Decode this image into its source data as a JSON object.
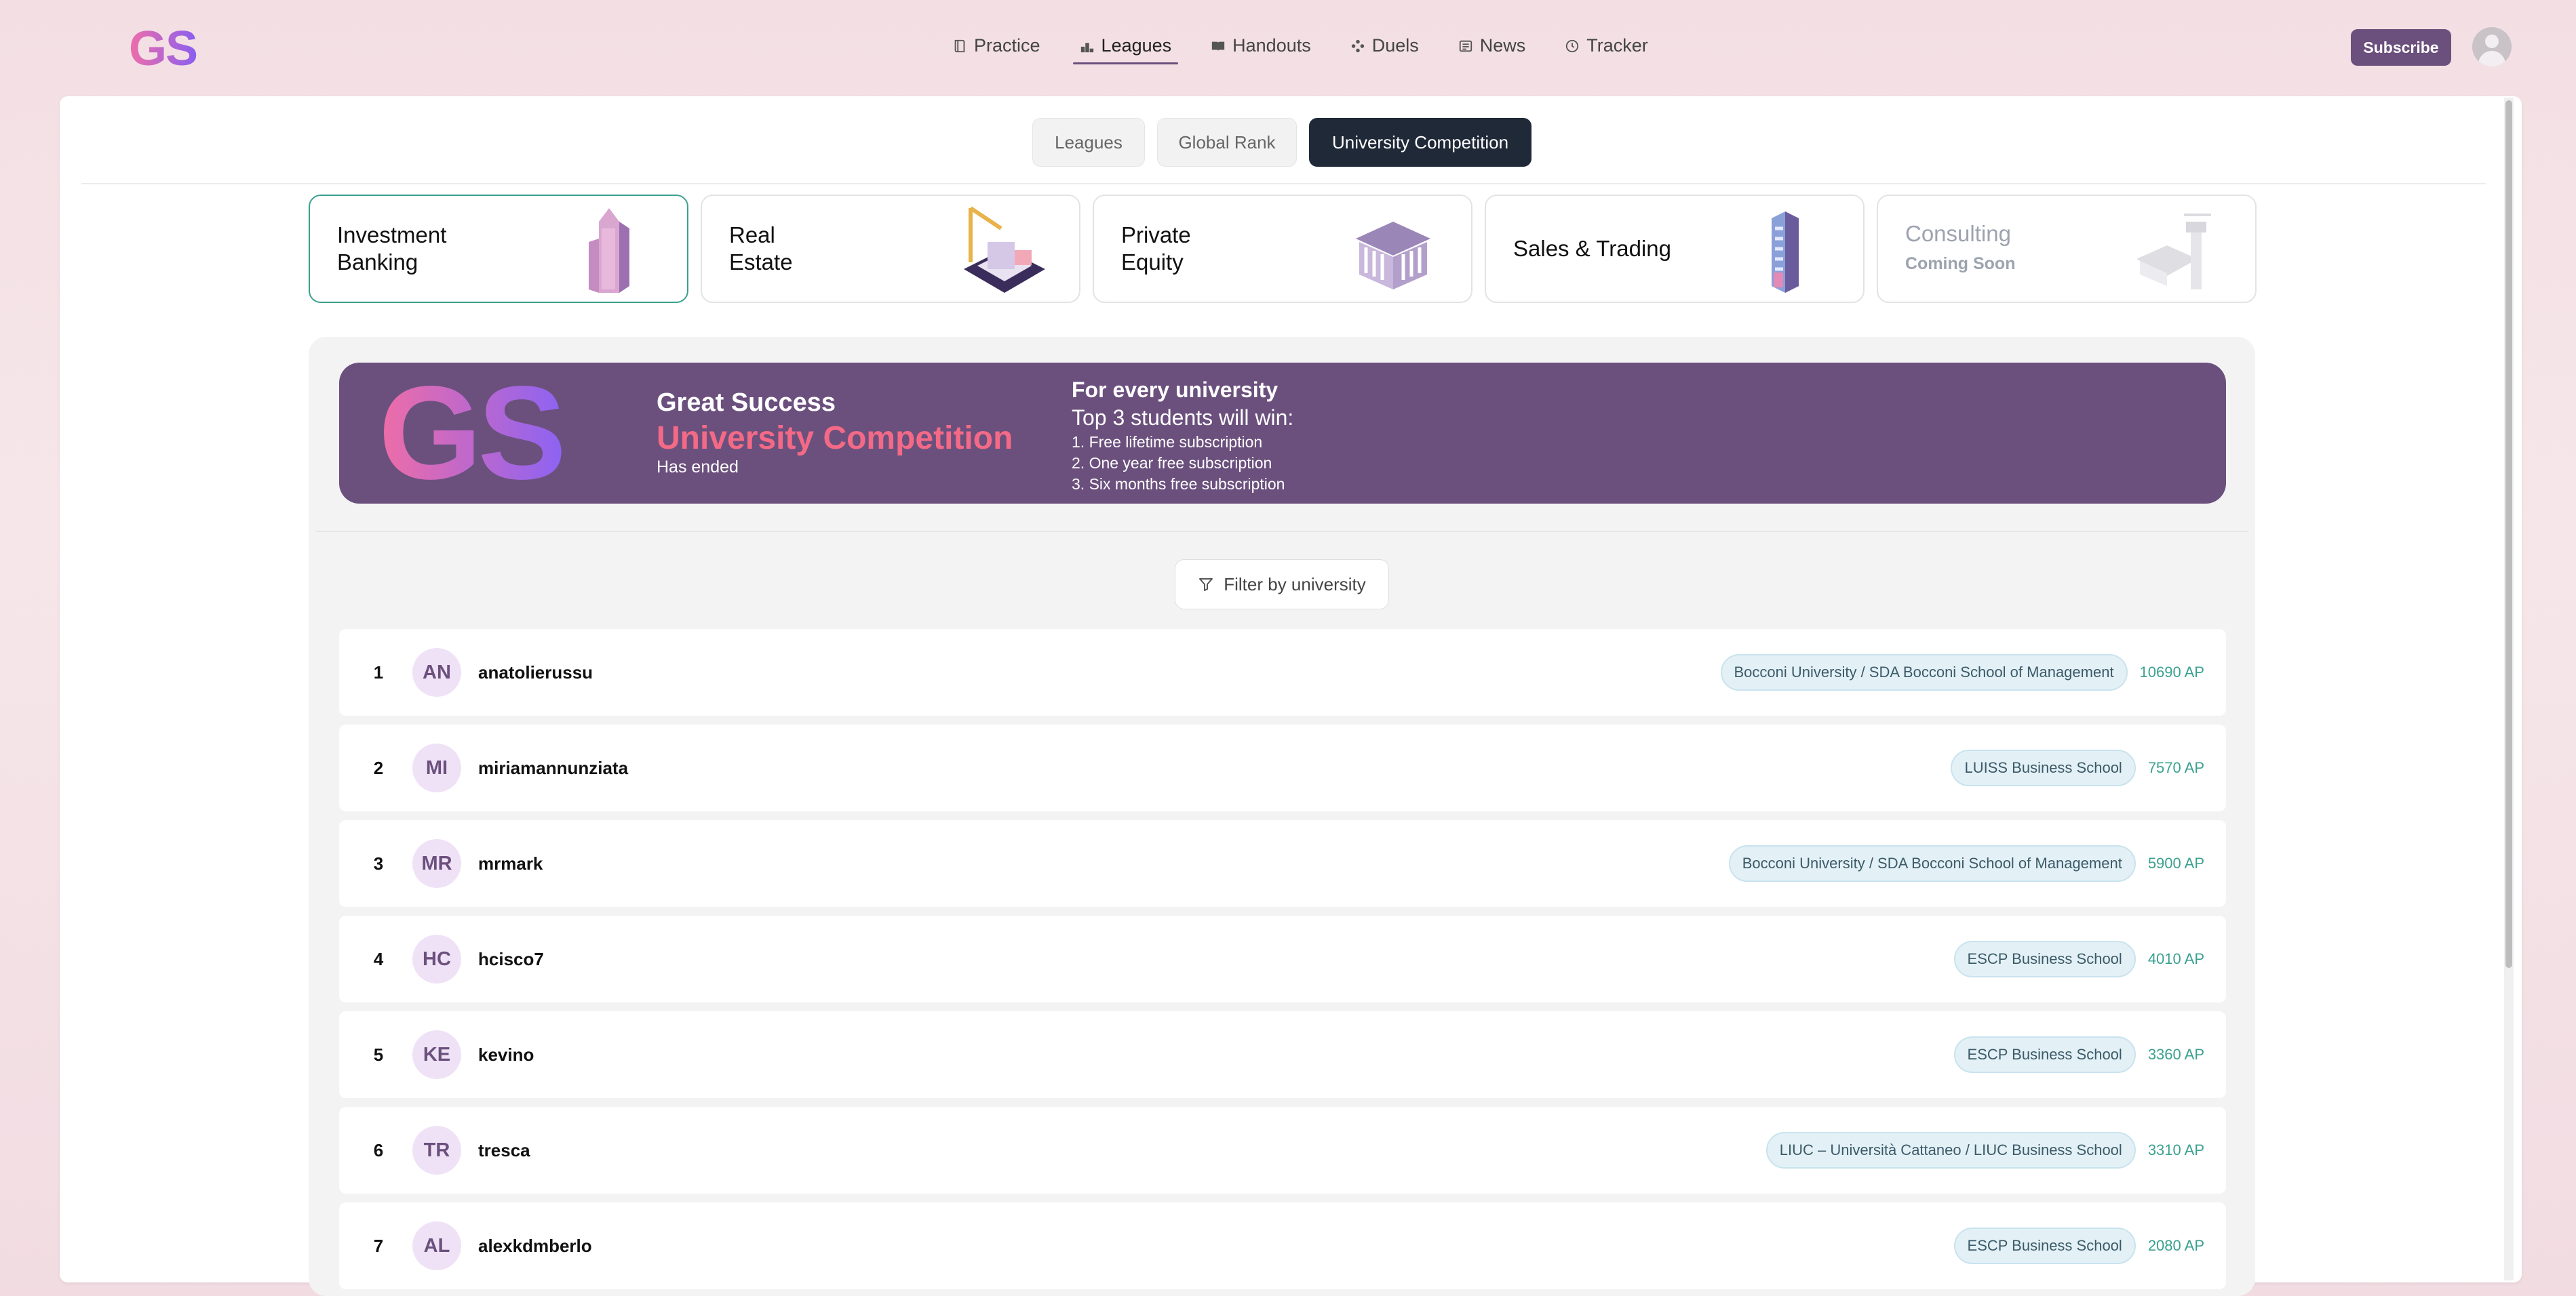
{
  "app": {
    "logo": "GS"
  },
  "nav": {
    "items": [
      {
        "label": "Practice",
        "icon": "book-icon"
      },
      {
        "label": "Leagues",
        "icon": "podium-icon",
        "active": true
      },
      {
        "label": "Handouts",
        "icon": "open-book-icon"
      },
      {
        "label": "Duels",
        "icon": "swords-icon"
      },
      {
        "label": "News",
        "icon": "newspaper-icon"
      },
      {
        "label": "Tracker",
        "icon": "clock-icon"
      }
    ],
    "subscribe_label": "Subscribe"
  },
  "tabs": [
    {
      "label": "Leagues"
    },
    {
      "label": "Global Rank"
    },
    {
      "label": "University Competition",
      "active": true
    }
  ],
  "categories": [
    {
      "line1": "Investment",
      "line2": "Banking",
      "active": true
    },
    {
      "line1": "Real",
      "line2": "Estate"
    },
    {
      "line1": "Private",
      "line2": "Equity"
    },
    {
      "line1": "Sales & Trading",
      "line2": ""
    },
    {
      "line1": "Consulting",
      "sub": "Coming Soon",
      "disabled": true
    }
  ],
  "banner": {
    "logo": "GS",
    "title": "Great Success",
    "competition": "University Competition",
    "status": "Has ended",
    "right_title": "For every university",
    "right_sub": "Top 3 students will win:",
    "prizes": [
      "1. Free lifetime subscription",
      "2. One year free subscription",
      "3. Six months free subscription"
    ]
  },
  "filter": {
    "label": "Filter by university"
  },
  "leaderboard": [
    {
      "rank": "1",
      "initials": "AN",
      "username": "anatolierussu",
      "university": "Bocconi University / SDA Bocconi School of Management",
      "points": "10690 AP"
    },
    {
      "rank": "2",
      "initials": "MI",
      "username": "miriamannunziata",
      "university": "LUISS Business School",
      "points": "7570 AP"
    },
    {
      "rank": "3",
      "initials": "MR",
      "username": "mrmark",
      "university": "Bocconi University / SDA Bocconi School of Management",
      "points": "5900 AP"
    },
    {
      "rank": "4",
      "initials": "HC",
      "username": "hcisco7",
      "university": "ESCP Business School",
      "points": "4010 AP"
    },
    {
      "rank": "5",
      "initials": "KE",
      "username": "kevino",
      "university": "ESCP Business School",
      "points": "3360 AP"
    },
    {
      "rank": "6",
      "initials": "TR",
      "username": "tresca",
      "university": "LIUC – Università Cattaneo / LIUC Business School",
      "points": "3310 AP"
    },
    {
      "rank": "7",
      "initials": "AL",
      "username": "alexkdmberlo",
      "university": "ESCP Business School",
      "points": "2080 AP"
    }
  ]
}
